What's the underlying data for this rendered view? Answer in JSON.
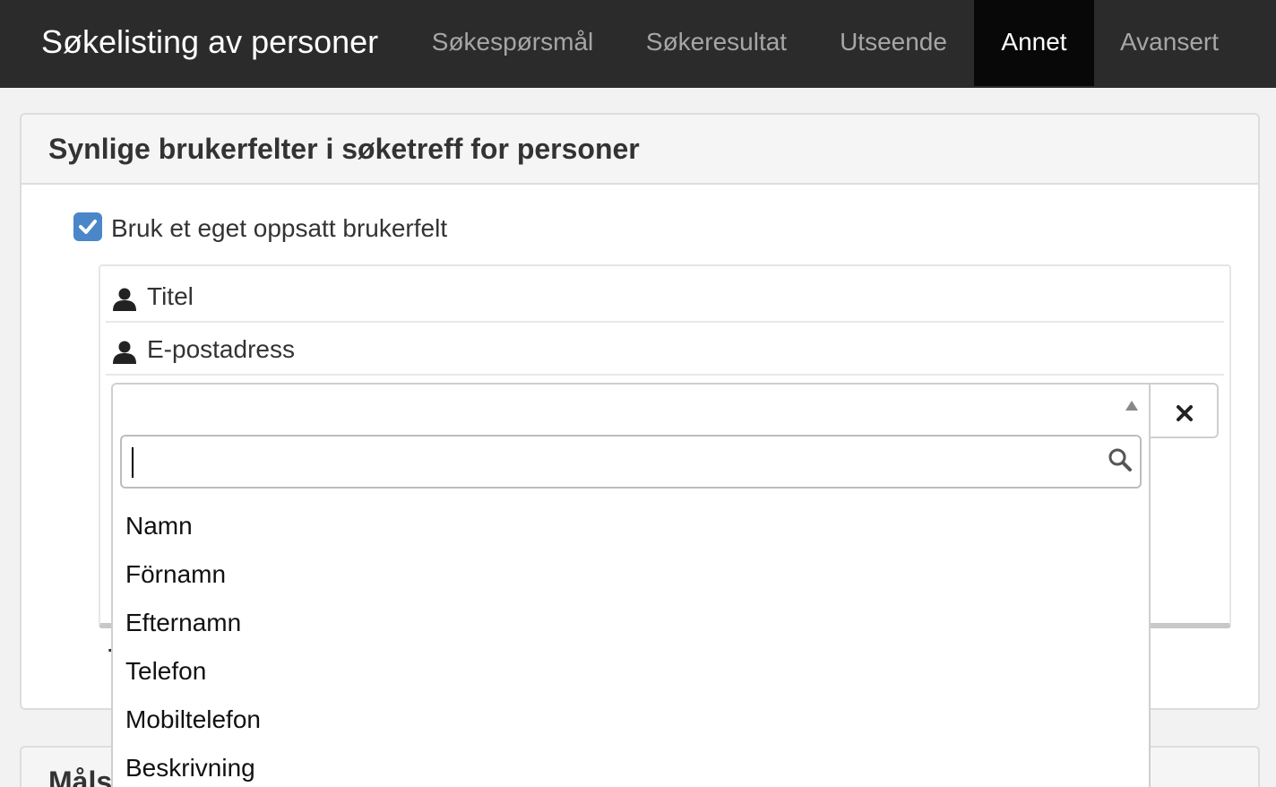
{
  "app": {
    "title": "Søkelisting av personer"
  },
  "nav": {
    "tabs": [
      {
        "label": "Søkespørsmål"
      },
      {
        "label": "Søkeresultat"
      },
      {
        "label": "Utseende"
      },
      {
        "label": "Annet",
        "active": true
      },
      {
        "label": "Avansert"
      }
    ]
  },
  "panel": {
    "title": "Synlige brukerfelter i søketreff for personer",
    "checkbox": {
      "label": "Bruk et eget oppsatt brukerfelt",
      "checked": true
    },
    "fields": [
      {
        "label": "Titel",
        "icon": "user-icon"
      },
      {
        "label": "E-postadress",
        "icon": "user-icon"
      }
    ],
    "select": {
      "value": "",
      "search_value": ""
    },
    "options": [
      "Namn",
      "Förnamn",
      "Efternamn",
      "Telefon",
      "Mobiltelefon",
      "Beskrivning"
    ]
  },
  "panel2": {
    "title_partial": "Måls"
  },
  "colors": {
    "navbar": "#2b2b2b",
    "nav_active": "#080808",
    "checkbox": "#4a86c8"
  }
}
